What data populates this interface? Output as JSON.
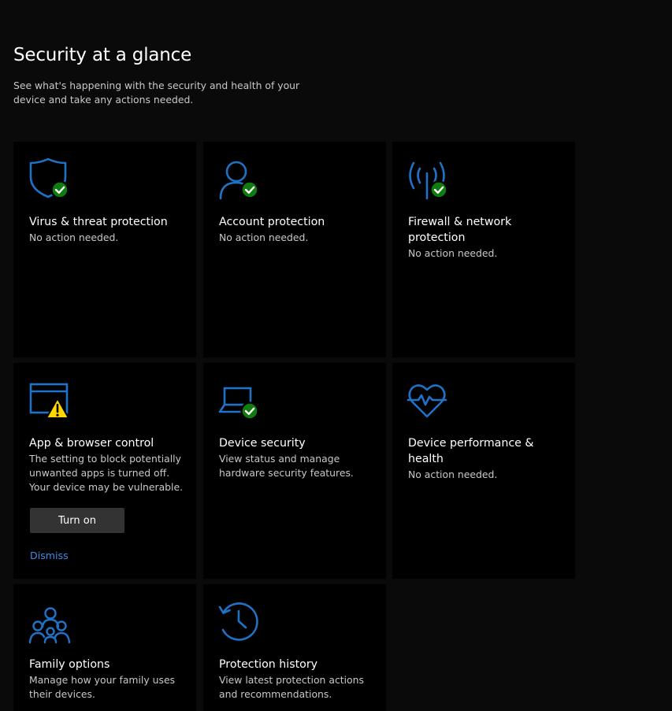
{
  "header": {
    "title": "Security at a glance",
    "subtitle": "See what's happening with the security and health of your device and take any actions needed."
  },
  "colors": {
    "accent": "#1e73c8",
    "ok": "#107c10",
    "warning": "#ffd700",
    "link": "#3c8ee6"
  },
  "tiles": [
    {
      "title": "Virus & threat protection",
      "description": "No action needed.",
      "icon": "shield-icon",
      "status": "ok"
    },
    {
      "title": "Account protection",
      "description": "No action needed.",
      "icon": "person-icon",
      "status": "ok"
    },
    {
      "title": "Firewall & network protection",
      "description": "No action needed.",
      "icon": "antenna-icon",
      "status": "ok"
    },
    {
      "title": "App & browser control",
      "description": "The setting to block potentially unwanted apps is turned off. Your device may be vulnerable.",
      "icon": "browser-window-icon",
      "status": "warning",
      "button_label": "Turn on",
      "link_label": "Dismiss"
    },
    {
      "title": "Device security",
      "description": "View status and manage hardware security features.",
      "icon": "laptop-icon",
      "status": "ok"
    },
    {
      "title": "Device performance & health",
      "description": "No action needed.",
      "icon": "heart-pulse-icon",
      "status": "none"
    },
    {
      "title": "Family options",
      "description": "Manage how your family uses their devices.",
      "icon": "family-icon",
      "status": "none"
    },
    {
      "title": "Protection history",
      "description": "View latest protection actions and recommendations.",
      "icon": "history-icon",
      "status": "none"
    }
  ]
}
